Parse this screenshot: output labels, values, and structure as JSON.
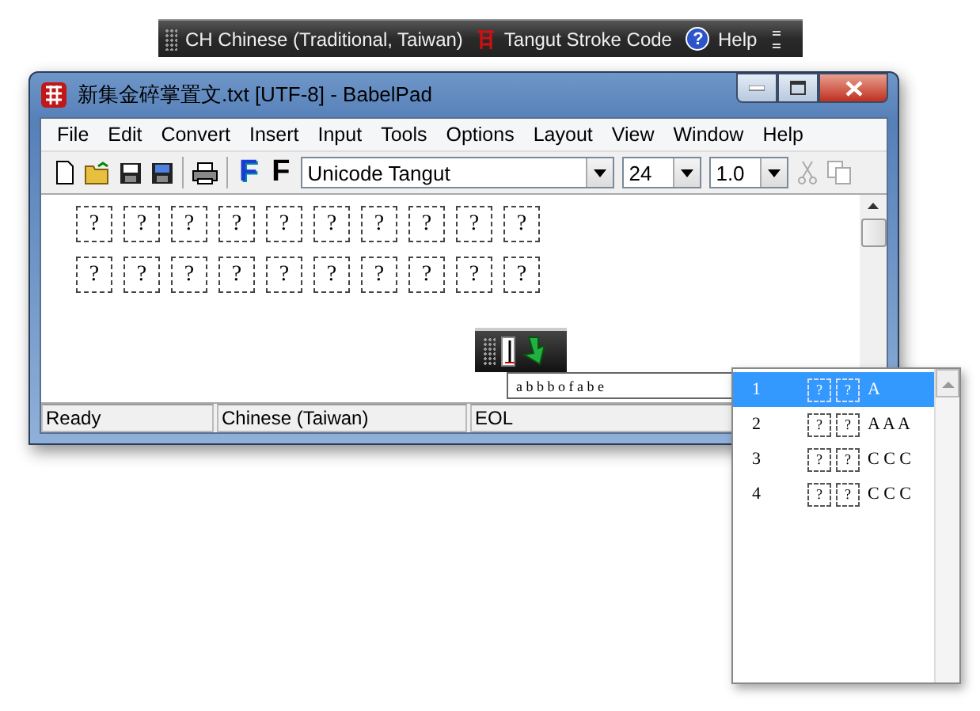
{
  "language_bar": {
    "language": "CH Chinese (Traditional, Taiwan)",
    "input_method": "Tangut Stroke Code",
    "help_icon": "?",
    "help": "Help"
  },
  "window": {
    "title": "新集金碎掌置文.txt [UTF-8] - BabelPad"
  },
  "menu": [
    "File",
    "Edit",
    "Convert",
    "Insert",
    "Input",
    "Tools",
    "Options",
    "Layout",
    "View",
    "Window",
    "Help"
  ],
  "toolbar": {
    "bold_font_button": "F",
    "font_button": "F",
    "font": "Unicode Tangut",
    "size": "24",
    "spacing": "1.0"
  },
  "editor": {
    "rows": [
      {
        "glyphs": [
          "?",
          "?",
          "?",
          "?",
          "?",
          "?",
          "?",
          "?",
          "?",
          "?"
        ]
      },
      {
        "glyphs": [
          "?",
          "?",
          "?",
          "?",
          "?",
          "?",
          "?",
          "?",
          "?",
          "?"
        ]
      }
    ]
  },
  "status_bar": [
    "Ready",
    "Chinese (Taiwan)",
    "EOL"
  ],
  "composition": {
    "text": "a b b b o f a b e"
  },
  "candidates": [
    {
      "number": "1",
      "glyphs": [
        "?",
        "?"
      ],
      "reading": "A",
      "selected": true
    },
    {
      "number": "2",
      "glyphs": [
        "?",
        "?"
      ],
      "reading": "A A A",
      "selected": false
    },
    {
      "number": "3",
      "glyphs": [
        "?",
        "?"
      ],
      "reading": "C C C",
      "selected": false
    },
    {
      "number": "4",
      "glyphs": [
        "?",
        "?"
      ],
      "reading": "C C C",
      "selected": false
    }
  ]
}
